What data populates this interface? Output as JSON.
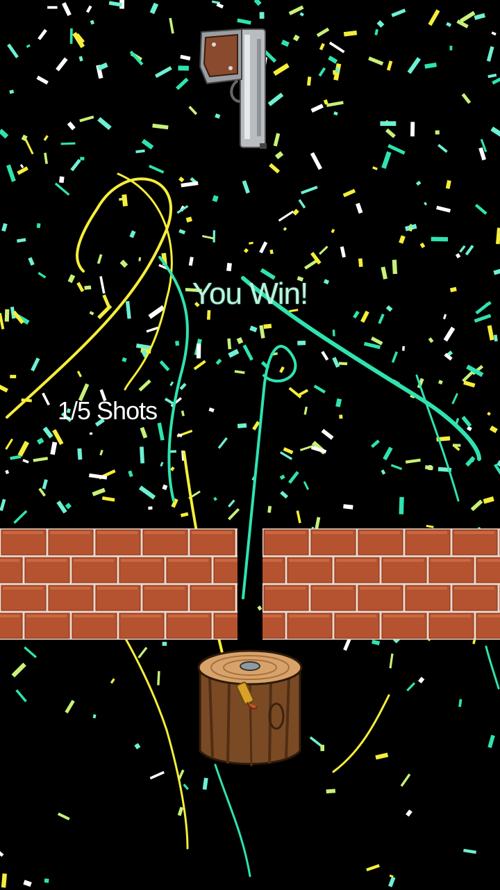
{
  "game": {
    "status_text": "You Win!",
    "shots_text": "1/5 Shots",
    "shots_used": 1,
    "shots_total": 5
  },
  "colors": {
    "background": "#000000",
    "win_text": "#b9f5dc",
    "shots_text": "#ffffff",
    "brick": "#b5522f",
    "mortar": "#f2d7c8",
    "confetti": [
      "#2fe3b0",
      "#f5ee3a",
      "#c8f07a",
      "#ffffff",
      "#6ef0d2"
    ]
  },
  "icons": {
    "weapon": "pistol-icon",
    "target": "tree-stump-icon",
    "projectile": "bullet-icon"
  }
}
